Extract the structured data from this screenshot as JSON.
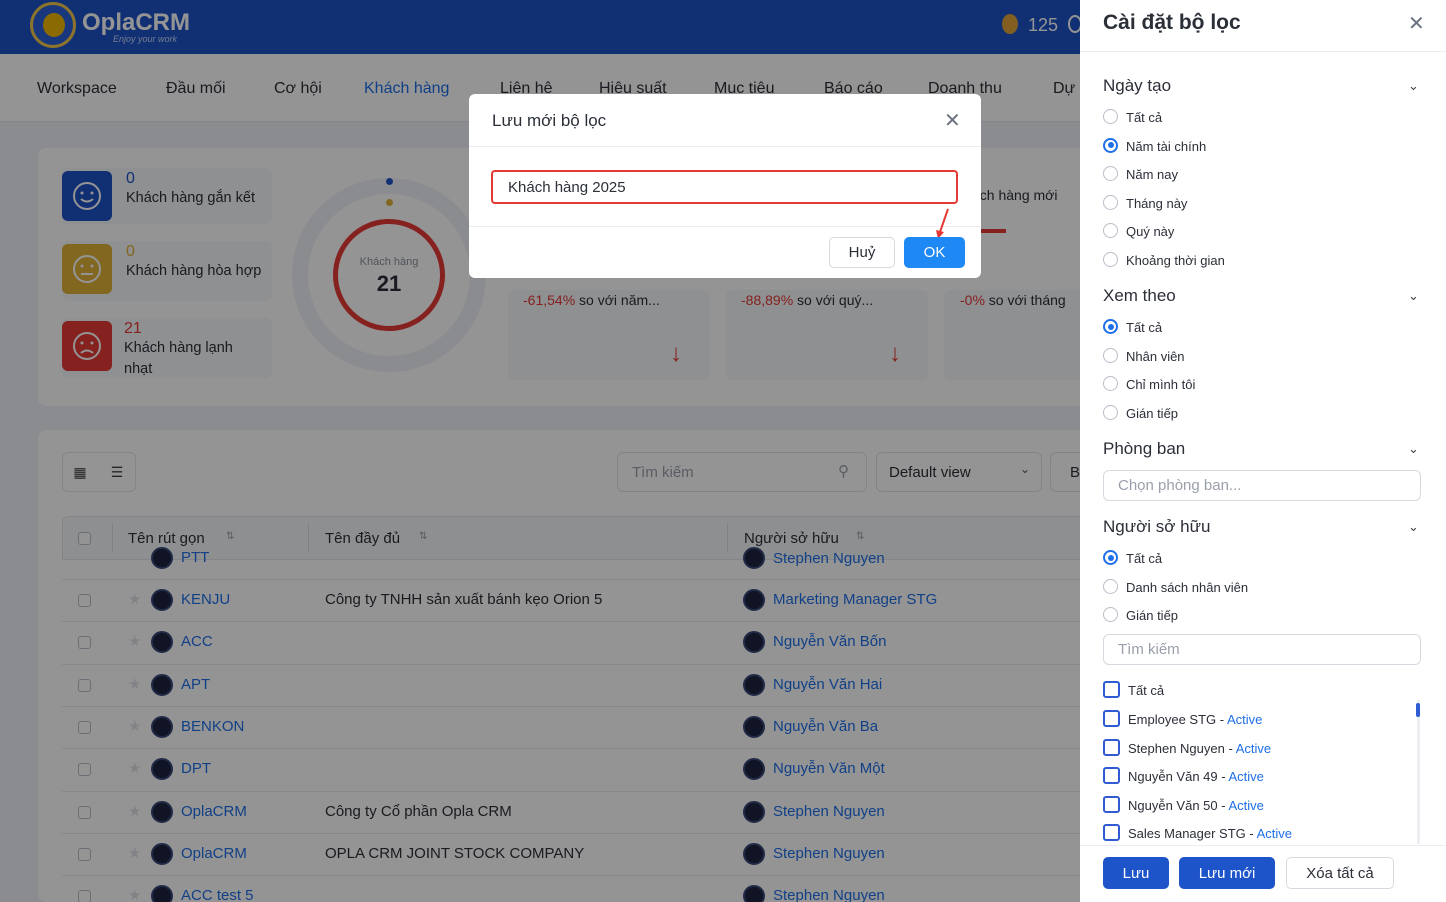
{
  "app": {
    "name": "OplaCRM",
    "tagline": "Enjoy your work",
    "coins": "125"
  },
  "nav": [
    "Workspace",
    "Đầu mối",
    "Cơ hội",
    "Khách hàng",
    "Liên hệ",
    "Hiệu suất",
    "Mục tiêu",
    "Báo cáo",
    "Doanh thu",
    "Dự"
  ],
  "nav_active": "Khách hàng",
  "stats": [
    {
      "value": "0",
      "label": "Khách hàng gắn kết",
      "color": "#1e54c9",
      "icon": "smile-face-icon"
    },
    {
      "value": "0",
      "label": "Khách hàng hòa hợp",
      "color": "#e0b23a",
      "icon": "neutral-face-icon"
    },
    {
      "value": "21",
      "label": "Khách hàng lạnh nhạt",
      "color": "#e53935",
      "icon": "sad-face-icon"
    }
  ],
  "donut": {
    "label": "Khách hàng",
    "value": "21"
  },
  "kpis": [
    {
      "percent": "-61,54%",
      "text": "so với năm..."
    },
    {
      "percent": "-88,89%",
      "text": "so với quý..."
    },
    {
      "percent": "-0%",
      "text": "so với tháng"
    }
  ],
  "kpi_partial_title": "ách hàng mới",
  "toolbar": {
    "search_placeholder": "Tìm kiếm",
    "view_label": "Default view",
    "more_label": "B"
  },
  "table": {
    "headers": [
      "Tên rút gọn",
      "Tên đầy đủ",
      "Người sở hữu"
    ],
    "partial_row": {
      "short": "PTT",
      "owner": "Stephen Nguyen"
    },
    "rows": [
      {
        "short": "KENJU",
        "full": "Công ty TNHH sản xuất bánh kẹo Orion 5",
        "owner": "Marketing Manager STG"
      },
      {
        "short": "ACC",
        "full": "",
        "owner": "Nguyễn Văn Bốn"
      },
      {
        "short": "APT",
        "full": "",
        "owner": "Nguyễn Văn Hai"
      },
      {
        "short": "BENKON",
        "full": "",
        "owner": "Nguyễn Văn Ba"
      },
      {
        "short": "DPT",
        "full": "",
        "owner": "Nguyễn Văn Một"
      },
      {
        "short": "OplaCRM",
        "full": "Công ty Cổ phần Opla CRM",
        "owner": "Stephen Nguyen"
      },
      {
        "short": "OplaCRM",
        "full": "OPLA CRM JOINT STOCK COMPANY",
        "owner": "Stephen Nguyen"
      },
      {
        "short": "ACC test 5",
        "full": "",
        "owner": "Stephen Nguyen"
      }
    ]
  },
  "modal": {
    "title": "Lưu mới bộ lọc",
    "input_value": "Khách hàng 2025",
    "cancel": "Huỷ",
    "ok": "OK"
  },
  "filter": {
    "title": "Cài đặt bộ lọc",
    "created": {
      "title": "Ngày tạo",
      "options": [
        "Tất cả",
        "Năm tài chính",
        "Năm nay",
        "Tháng này",
        "Quý này",
        "Khoảng thời gian"
      ],
      "selected": 1
    },
    "view_by": {
      "title": "Xem theo",
      "options": [
        "Tất cả",
        "Nhân viên",
        "Chỉ mình tôi",
        "Gián tiếp"
      ],
      "selected": 0
    },
    "department": {
      "title": "Phòng ban",
      "placeholder": "Chọn phòng ban..."
    },
    "owner": {
      "title": "Người sở hữu",
      "options": [
        "Tất cả",
        "Danh sách nhân viên",
        "Gián tiếp"
      ],
      "selected": 0,
      "search_placeholder": "Tìm kiếm",
      "check_all": "Tất cả",
      "employees": [
        {
          "name": "Employee STG - ",
          "status": "Active"
        },
        {
          "name": "Stephen Nguyen - ",
          "status": "Active"
        },
        {
          "name": "Nguyễn Văn 49 - ",
          "status": "Active"
        },
        {
          "name": "Nguyễn Văn 50 - ",
          "status": "Active"
        },
        {
          "name": "Sales Manager STG - ",
          "status": "Active"
        }
      ]
    },
    "buttons": {
      "save": "Lưu",
      "save_new": "Lưu mới",
      "clear": "Xóa tất cả"
    }
  }
}
